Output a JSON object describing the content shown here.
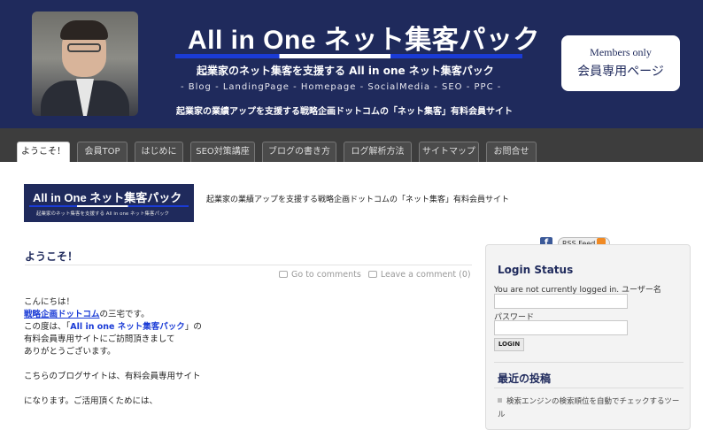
{
  "header": {
    "title": "All in One ネット集客パック",
    "subtitle": "起業家のネット集客を支援する All in one ネット集客パック",
    "tagline": "- Blog - LandingPage - Homepage - SocialMedia - SEO - PPC -",
    "description": "起業家の業績アップを支援する戦略企画ドットコムの「ネット集客」有料会員サイト",
    "members_en": "Members only",
    "members_jp": "会員専用ページ"
  },
  "nav": {
    "tabs": [
      {
        "label": "ようこそ！"
      },
      {
        "label": "会員TOP"
      },
      {
        "label": "はじめに"
      },
      {
        "label": "SEO対策講座"
      },
      {
        "label": "ブログの書き方"
      },
      {
        "label": "ログ解析方法"
      },
      {
        "label": "サイトマップ"
      },
      {
        "label": "お問合せ"
      }
    ]
  },
  "site": {
    "logo_title": "All in One ネット集客パック",
    "logo_sub": "起業家のネット集客を支援する All in one ネット集客パック",
    "description": "起業家の業績アップを支援する戦略企画ドットコムの「ネット集客」有料会員サイト"
  },
  "post": {
    "title": "ようこそ！",
    "go_to_comments": "Go to comments",
    "leave_comment": "Leave a comment (0)",
    "line1": "こんにちは！",
    "link_text": "戦略企画ドットコム",
    "line2_suffix": "の三宅です。",
    "line3_prefix": "この度は、「",
    "line3_bold": "All in one ネット集客パック",
    "line3_suffix": "」の",
    "line4": "有料会員専用サイトにご訪問頂きまして",
    "line5": "ありがとうございます。",
    "line6": "こちらのブログサイトは、有料会員専用サイト",
    "line7": "になります。ご活用頂くためには、"
  },
  "sidebar": {
    "rss_label": "RSS Feed",
    "login_heading": "Login Status",
    "login_status": "You are not currently logged in. ユーザー名",
    "password_label": "パスワード",
    "login_button": "LOGIN",
    "recent_heading": "最近の投稿",
    "recent_item": "検索エンジンの検索順位を自動でチェックするツール"
  }
}
